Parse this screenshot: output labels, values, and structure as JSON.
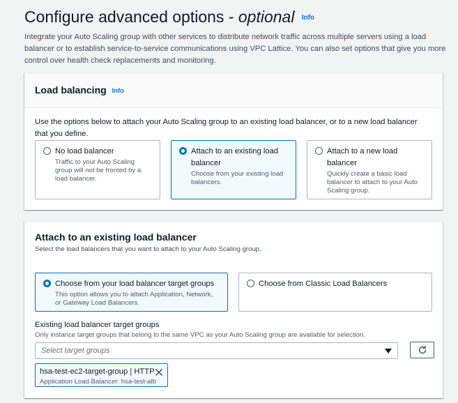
{
  "header": {
    "title_main": "Configure advanced options - ",
    "title_optional": "optional",
    "info": "Info",
    "description": "Integrate your Auto Scaling group with other services to distribute network traffic across multiple servers using a load balancer or to establish service-to-service communications using VPC Lattice. You can also set options that give you more control over health check replacements and monitoring."
  },
  "load_balancing": {
    "title": "Load balancing",
    "info": "Info",
    "intro": "Use the options below to attach your Auto Scaling group to an existing load balancer, or to a new load balancer that you define.",
    "options": [
      {
        "title": "No load balancer",
        "desc": "Traffic to your Auto Scaling group will not be fronted by a load balancer.",
        "selected": false
      },
      {
        "title": "Attach to an existing load balancer",
        "desc": "Choose from your existing load balancers.",
        "selected": true
      },
      {
        "title": "Attach to a new load balancer",
        "desc": "Quickly create a basic load balancer to attach to your Auto Scaling group.",
        "selected": false
      }
    ]
  },
  "attach": {
    "title": "Attach to an existing load balancer",
    "subtitle": "Select the load balancers that you want to attach to your Auto Scaling group.",
    "options": [
      {
        "title": "Choose from your load balancer target groups",
        "desc": "This option allows you to attach Application, Network, or Gateway Load Balancers.",
        "selected": true
      },
      {
        "title": "Choose from Classic Load Balancers",
        "desc": "",
        "selected": false
      }
    ],
    "field_label": "Existing load balancer target groups",
    "field_help": "Only instance target groups that belong to the same VPC as your Auto Scaling group are available for selection.",
    "select_placeholder": "Select target groups",
    "selected_token": {
      "title": "hsa-test-ec2-target-group | HTTP",
      "subtitle": "Application Load Balancer: hsa-test-alb"
    }
  },
  "icons": {
    "caret": "caret-down-icon",
    "refresh": "refresh-icon",
    "dismiss": "close-icon"
  },
  "colors": {
    "accent": "#0073bb",
    "link": "#0972d3",
    "background": "#f2f3f3"
  }
}
